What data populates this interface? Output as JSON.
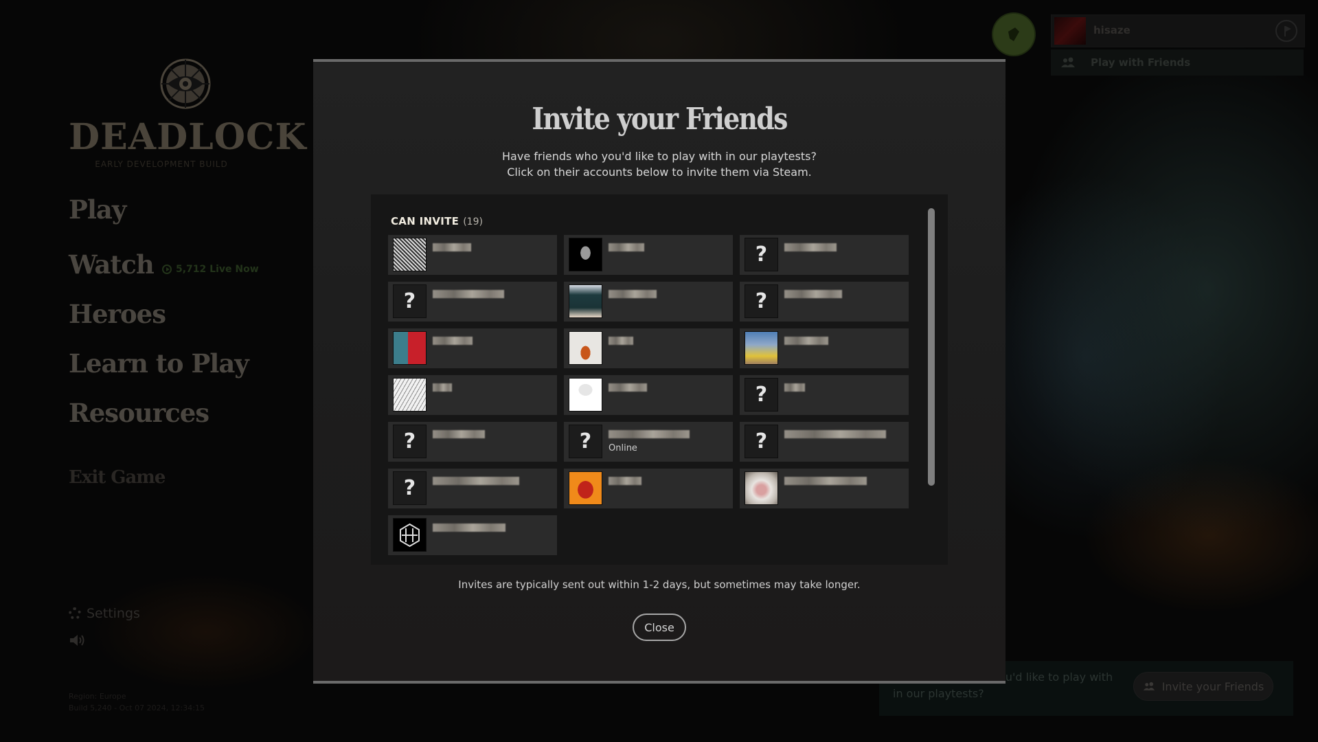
{
  "app": {
    "logo_word": "DEADLOCK",
    "logo_subtitle": "EARLY DEVELOPMENT BUILD"
  },
  "nav": {
    "items": [
      {
        "label": "Play"
      },
      {
        "label": "Watch",
        "badge": "5,712 Live Now"
      },
      {
        "label": "Heroes"
      },
      {
        "label": "Learn to Play"
      },
      {
        "label": "Resources"
      }
    ],
    "exit_label": "Exit Game",
    "settings_label": "Settings"
  },
  "build_info": {
    "region": "Region: Europe",
    "build": "Build 5,240 - Oct 07 2024, 12:34:15"
  },
  "top_right": {
    "username": "hisaze",
    "play_with_friends": "Play with Friends"
  },
  "promo": {
    "text": "Have friends who you'd like to play with in our playtests?",
    "button_label": "Invite your Friends"
  },
  "colors": {
    "accent_green": "#2c3b18",
    "modal_bg": "#1f1f1f",
    "card_bg": "#2b2b2b",
    "panel_bg": "#161616"
  },
  "modal": {
    "title": "Invite your Friends",
    "subtitle_line1": "Have friends who you'd like to play with in our playtests?",
    "subtitle_line2": "Click on their accounts below to invite them via Steam.",
    "section_label": "CAN INVITE",
    "section_count": "(19)",
    "footer_note": "Invites are typically sent out within 1-2 days, but sometimes may take longer.",
    "close_label": "Close",
    "friends": [
      {
        "avatar": "sketch-art",
        "status": ""
      },
      {
        "avatar": "skull",
        "status": ""
      },
      {
        "avatar": "unknown",
        "status": ""
      },
      {
        "avatar": "unknown",
        "status": ""
      },
      {
        "avatar": "anime-girl",
        "status": ""
      },
      {
        "avatar": "unknown",
        "status": ""
      },
      {
        "avatar": "portrait-poster",
        "status": ""
      },
      {
        "avatar": "orange-drop",
        "status": ""
      },
      {
        "avatar": "man-with-car",
        "status": ""
      },
      {
        "avatar": "sketch-white",
        "status": ""
      },
      {
        "avatar": "masked-anime",
        "status": ""
      },
      {
        "avatar": "unknown",
        "status": ""
      },
      {
        "avatar": "unknown",
        "status": ""
      },
      {
        "avatar": "unknown",
        "status": "Online"
      },
      {
        "avatar": "unknown",
        "status": ""
      },
      {
        "avatar": "unknown",
        "status": ""
      },
      {
        "avatar": "red-demon",
        "status": ""
      },
      {
        "avatar": "animal-closeup",
        "status": ""
      },
      {
        "avatar": "hex-logo",
        "status": ""
      }
    ],
    "unknown_glyph": "?"
  }
}
